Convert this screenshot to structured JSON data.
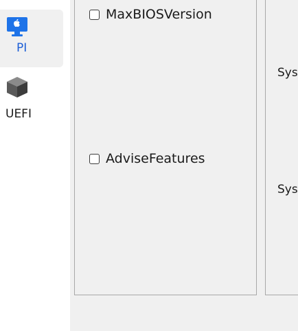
{
  "sidebar": {
    "items": [
      {
        "label": "PI",
        "icon": "monitor-apple-icon",
        "selected": true
      },
      {
        "label": "UEFI",
        "icon": "cube-icon",
        "selected": false
      }
    ]
  },
  "options": {
    "items": [
      {
        "label": "MaxBIOSVersion",
        "checked": false
      },
      {
        "label": "AdviseFeatures",
        "checked": false
      }
    ]
  },
  "right_panel": {
    "labels": [
      "Sys",
      "Sys"
    ]
  },
  "colors": {
    "accent": "#1e5fd6",
    "panel_bg": "#f0f0f0",
    "border": "#a8a8a8"
  }
}
